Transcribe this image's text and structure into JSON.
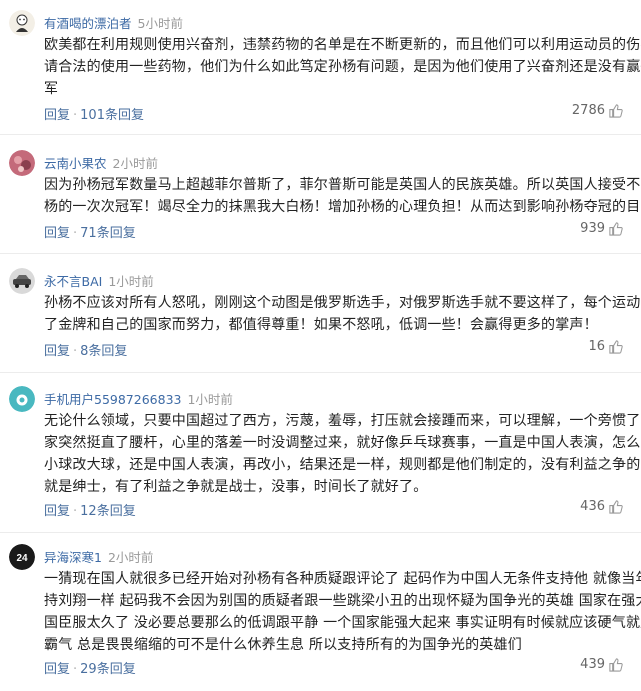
{
  "comments": [
    {
      "user": "有酒喝的漂泊者",
      "time": "5小时前",
      "avatar_icon": "avatar-cartoon-icon",
      "lines": [
        "欧美都在利用规则使用兴奋剂，违禁药物的名单是在不断更新的，而且他们可以利用运动员的伤病申",
        "请合法的使用一些药物，他们为什么如此笃定孙杨有问题，是因为他们使用了兴奋剂还是没有赢得冠",
        "军"
      ],
      "reply_label": "回复",
      "reply_count": "101条回复",
      "likes": "2786"
    },
    {
      "user": "云南小果农",
      "time": "2小时前",
      "avatar_icon": "avatar-photo-icon",
      "lines": [
        "因为孙杨冠军数量马上超越菲尔普斯了，菲尔普斯可能是英国人的民族英雄。所以英国人接受不了孙",
        "杨的一次次冠军！竭尽全力的抹黑我大白杨！增加孙杨的心理负担！从而达到影响孙杨夺冠的目的！"
      ],
      "reply_label": "回复",
      "reply_count": "71条回复",
      "likes": "939"
    },
    {
      "user": "永不言BAI",
      "time": "1小时前",
      "avatar_icon": "avatar-car-icon",
      "lines": [
        "孙杨不应该对所有人怒吼，刚刚这个动图是俄罗斯选手，对俄罗斯选手就不要这样了，每个运动员为",
        "了金牌和自己的国家而努力，都值得尊重！如果不怒吼，低调一些！会赢得更多的掌声！"
      ],
      "reply_label": "回复",
      "reply_count": "8条回复",
      "likes": "16"
    },
    {
      "user": "手机用户55987266833",
      "time": "1小时前",
      "avatar_icon": "avatar-default-icon",
      "lines": [
        "无论什么领域，只要中国超过了西方，污蔑，羞辱，打压就会接踵而来，可以理解，一个旁惯了的国",
        "家突然挺直了腰杆，心里的落差一时没调整过来，就好像乒乓球赛事，一直是中国人表演，怎么办？",
        "小球改大球，还是中国人表演，再改小，结果还是一样，规则都是他们制定的，没有利益之争的时候",
        "就是绅士，有了利益之争就是战士，没事，时间长了就好了。"
      ],
      "reply_label": "回复",
      "reply_count": "12条回复",
      "likes": "436"
    },
    {
      "user": "异海深寒1",
      "time": "2小时前",
      "avatar_icon": "avatar-jersey-24-icon",
      "avatar_text": "24",
      "lines": [
        "一猜现在国人就很多已经开始对孙杨有各种质疑跟评论了 起码作为中国人无条件支持他 就像当年支",
        "持刘翔一样 起码我不会因为别国的质疑者跟一些跳梁小丑的出现怀疑为国争光的英雄 国家在强大 中",
        "国臣服太久了 没必要总要那么的低调跟平静 一个国家能强大起来 事实证明有时候就应该硬气就应该",
        "霸气 总是畏畏缩缩的可不是什么休养生息 所以支持所有的为国争光的英雄们"
      ],
      "reply_label": "回复",
      "reply_count": "29条回复",
      "likes": "439"
    }
  ],
  "colors": {
    "username": "#3d6aa5",
    "reply_link": "#4a6f9f",
    "time": "#9a9a9a",
    "body": "#222222",
    "divider": "#ececec"
  }
}
